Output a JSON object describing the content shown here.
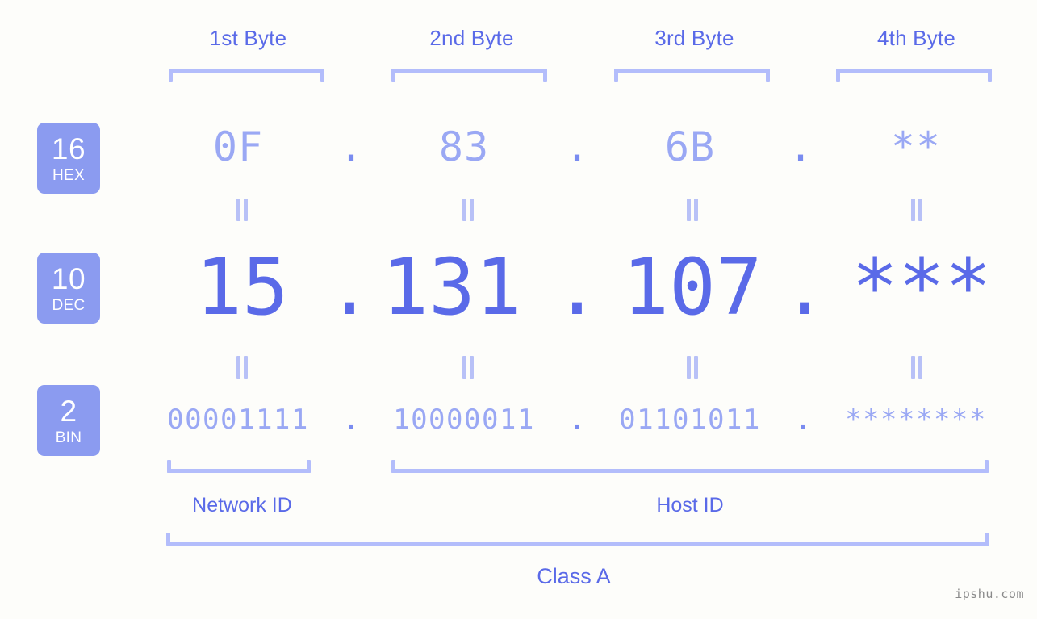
{
  "watermark": "ipshu.com",
  "byte_headers": [
    {
      "label": "1st Byte"
    },
    {
      "label": "2nd Byte"
    },
    {
      "label": "3rd Byte"
    },
    {
      "label": "4th Byte"
    }
  ],
  "bases": [
    {
      "num": "16",
      "word": "HEX"
    },
    {
      "num": "10",
      "word": "DEC"
    },
    {
      "num": "2",
      "word": "BIN"
    }
  ],
  "rows": {
    "hex": {
      "values": [
        "0F",
        "83",
        "6B",
        "**"
      ],
      "separator": "."
    },
    "dec": {
      "values": [
        "15",
        "131",
        "107",
        "***"
      ],
      "separator": "."
    },
    "bin": {
      "values": [
        "00001111",
        "10000011",
        "01101011",
        "********"
      ],
      "separator": "."
    }
  },
  "regions": [
    {
      "label": "Network ID"
    },
    {
      "label": "Host ID"
    }
  ],
  "class": {
    "label": "Class A"
  },
  "colors": {
    "background": "#fdfdfa",
    "accent_strong": "#5a6ae8",
    "accent_mid": "#8b9bf0",
    "accent_light": "#9aa8f4",
    "bracket": "#b3bdfb",
    "badge_bg": "#8b9bf0",
    "badge_text": "#ffffff",
    "watermark": "#8a8a8a"
  }
}
